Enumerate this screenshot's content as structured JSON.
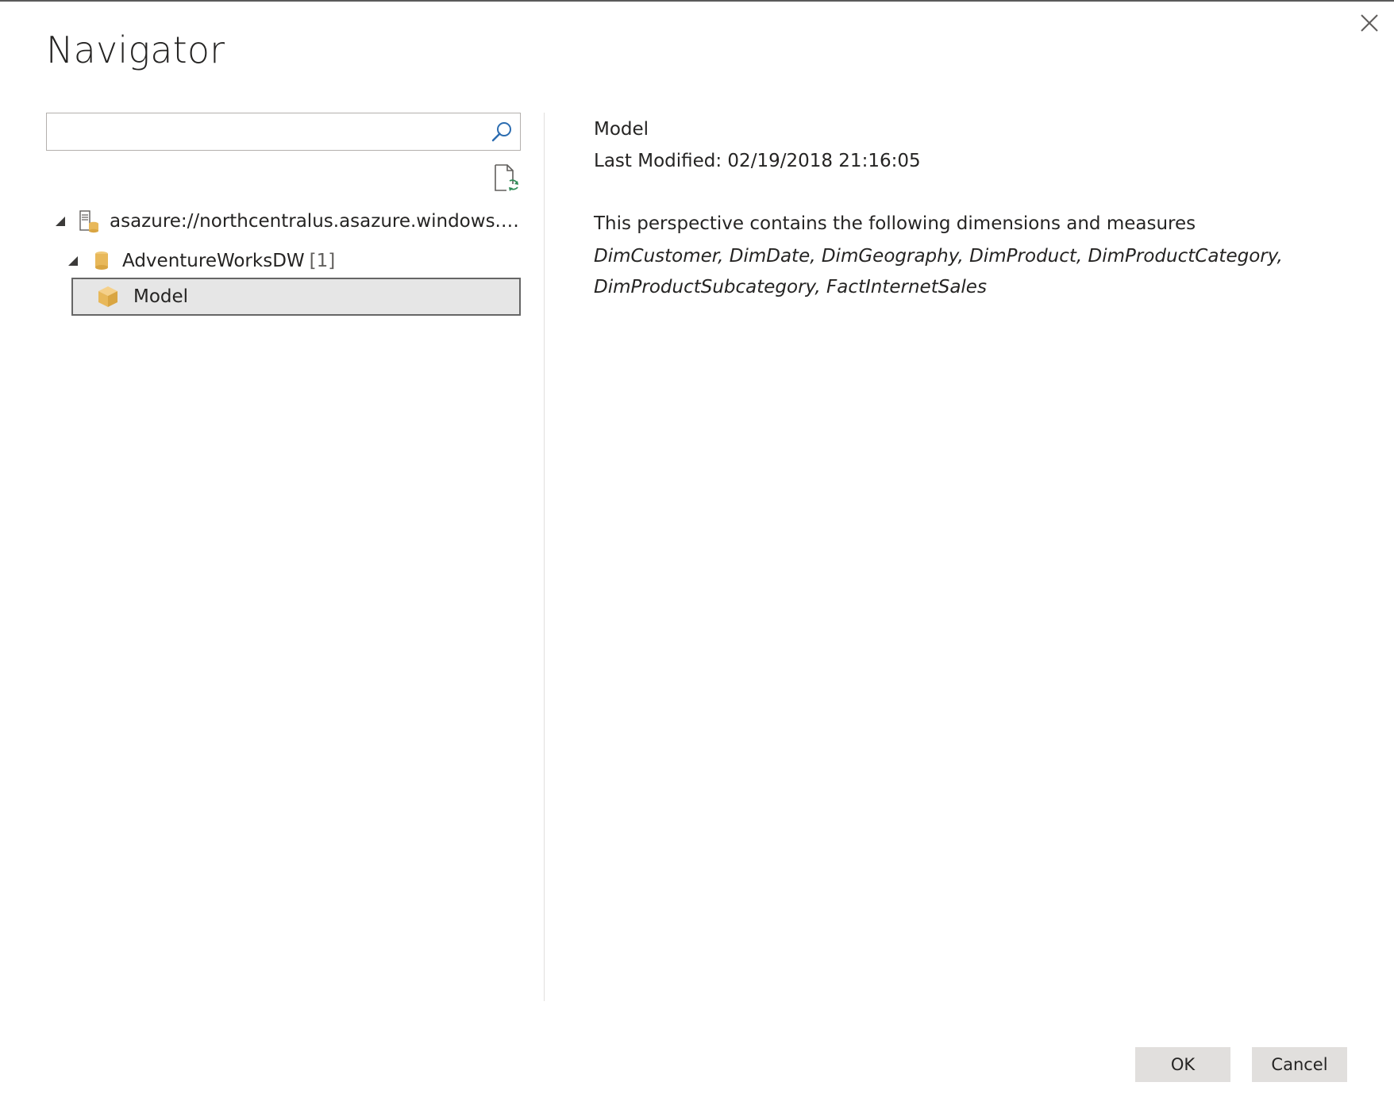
{
  "dialog": {
    "title": "Navigator"
  },
  "search": {
    "value": "",
    "placeholder": ""
  },
  "tree": {
    "server": {
      "label": "asazure://northcentralus.asazure.windows.net/...",
      "expanded": true,
      "icon": "server-icon"
    },
    "database": {
      "label": "AdventureWorksDW",
      "count": "[1]",
      "expanded": true,
      "icon": "database-icon"
    },
    "model": {
      "label": "Model",
      "selected": true,
      "icon": "cube-icon"
    }
  },
  "preview": {
    "title": "Model",
    "last_modified": "Last Modified: 02/19/2018 21:16:05",
    "description": "This perspective contains the following dimensions and measures",
    "items": "DimCustomer, DimDate, DimGeography, DimProduct, DimProductCategory, DimProductSubcategory, FactInternetSales"
  },
  "buttons": {
    "ok_label": "OK",
    "cancel_label": "Cancel"
  },
  "colors": {
    "accent_blue": "#2b6cb0",
    "db_yellow": "#e8b85a",
    "selection_bg": "#e6e6e6",
    "button_bg": "#e1dfdd"
  }
}
